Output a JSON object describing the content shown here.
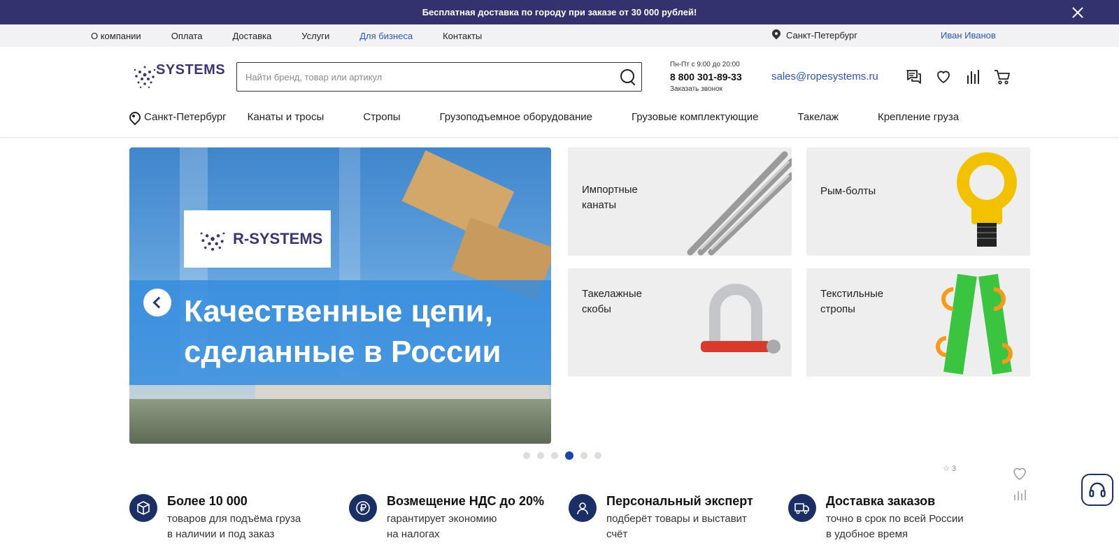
{
  "promo": {
    "text": "Бесплатная доставка по городу при заказе от 30 000 рублей!"
  },
  "topnav": {
    "links": [
      "О компании",
      "Оплата",
      "Доставка",
      "Услуги",
      "Для бизнеса",
      "Контакты"
    ],
    "accent_index": 4,
    "city": "Санкт-Петербург",
    "user": "Иван Иванов"
  },
  "header": {
    "logo_text": "SYSTEMS",
    "search_placeholder": "Найти бренд, товар или артикул",
    "hours": "Пн-Пт с 9:00 до 20:00",
    "phone": "8 800 301-89-33",
    "callback": "Заказать звонок",
    "email": "sales@ropesystems.ru",
    "icons": [
      "chat-icon",
      "heart-icon",
      "compare-icon",
      "cart-icon"
    ]
  },
  "catbar": {
    "city": "Санкт-Петербург",
    "categories": [
      "Канаты и тросы",
      "Стропы",
      "Грузоподъемное оборудование",
      "Грузовые комплектующие",
      "Такелаж",
      "Крепление груза"
    ]
  },
  "banner": {
    "logo_text": "R-SYSTEMS",
    "title_line1": "Качественные цепи,",
    "title_line2": "сделанные в России",
    "dots_count": 6,
    "active_dot": 3
  },
  "tiles": [
    {
      "label": "Импортные\nканаты",
      "icon": "wire-rope-icon"
    },
    {
      "label": "Рым-болты",
      "icon": "eye-bolt-icon"
    },
    {
      "label": "Такелажные\nскобы",
      "icon": "shackle-icon"
    },
    {
      "label": "Текстильные\nстропы",
      "icon": "textile-sling-icon"
    }
  ],
  "rating_mini": "☆ 3",
  "features": [
    {
      "icon": "box-icon",
      "title": "Более 10 000",
      "sub1": "товаров для подъёма груза",
      "sub2": "в наличии и под заказ"
    },
    {
      "icon": "ruble-icon",
      "title": "Возмещение НДС до 20%",
      "sub1": "гарантирует экономию",
      "sub2": "на налогах"
    },
    {
      "icon": "expert-icon",
      "title": "Персональный эксперт",
      "sub1": "подберёт товары и выставит",
      "sub2": "счёт"
    },
    {
      "icon": "truck-icon",
      "title": "Доставка заказов",
      "sub1": "точно в срок по всей России",
      "sub2": "в удобное время"
    }
  ],
  "colors": {
    "brand": "#34326e",
    "accent": "#2b55c6",
    "dark": "#1b2f66",
    "banner_blue": "#348cde"
  }
}
